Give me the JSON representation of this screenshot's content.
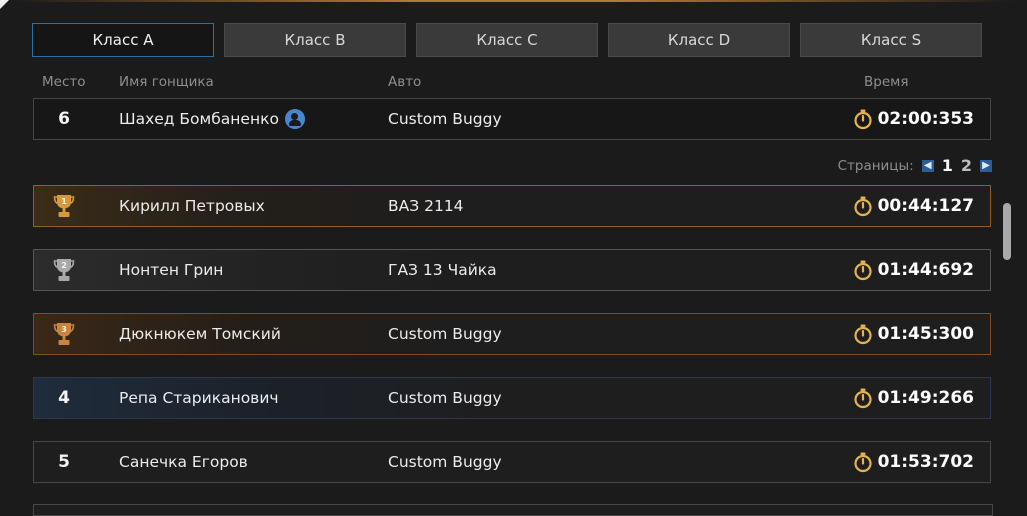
{
  "tabs": [
    {
      "label": "Класс A",
      "active": true
    },
    {
      "label": "Класс B",
      "active": false
    },
    {
      "label": "Класс C",
      "active": false
    },
    {
      "label": "Класс D",
      "active": false
    },
    {
      "label": "Класс S",
      "active": false
    }
  ],
  "headers": {
    "place": "Место",
    "name": "Имя гонщика",
    "car": "Авто",
    "time": "Время"
  },
  "my_result": {
    "place": "6",
    "name": "Шахед Бомбаненко",
    "car": "Custom Buggy",
    "time": "02:00:353"
  },
  "pager": {
    "label": "Страницы:",
    "pages": [
      "1",
      "2"
    ],
    "current": "1"
  },
  "leaderboard": [
    {
      "place": "1",
      "name": "Кирилл Петровых",
      "car": "ВАЗ 2114",
      "time": "00:44:127",
      "medal": "gold"
    },
    {
      "place": "2",
      "name": "Нонтен Грин",
      "car": "ГАЗ 13 Чайка",
      "time": "01:44:692",
      "medal": "silver"
    },
    {
      "place": "3",
      "name": "Дюкнюкем Томский",
      "car": "Custom Buggy",
      "time": "01:45:300",
      "medal": "bronze"
    },
    {
      "place": "4",
      "name": "Репа Стариканович",
      "car": "Custom Buggy",
      "time": "01:49:266",
      "medal": "none"
    },
    {
      "place": "5",
      "name": "Санечка Егоров",
      "car": "Custom Buggy",
      "time": "01:53:702",
      "medal": "none"
    }
  ],
  "colors": {
    "accent": "#2f6ea8",
    "gold": "#d79a3b",
    "silver": "#a9a9a9",
    "bronze": "#c9843e",
    "timer": "#e6b24a"
  },
  "icons": {
    "timer": "stopwatch-icon",
    "user": "user-icon",
    "trophy": "trophy-icon",
    "prev": "chevron-left-icon",
    "next": "chevron-right-icon"
  }
}
